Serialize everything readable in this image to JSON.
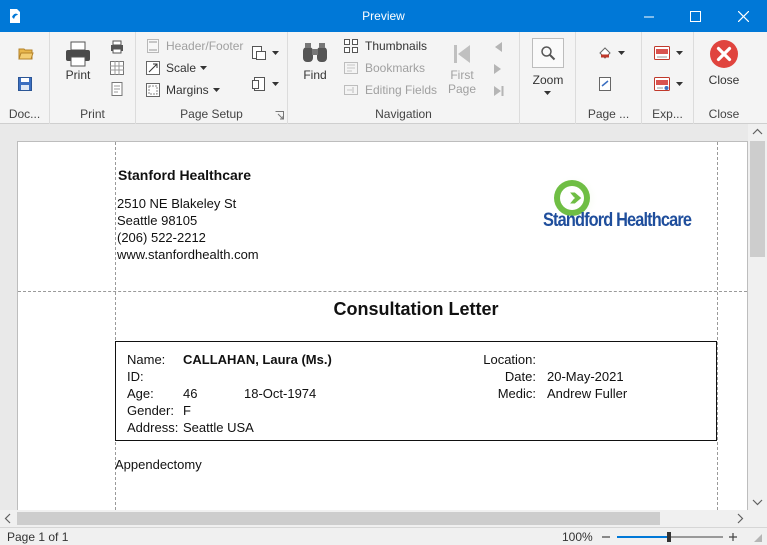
{
  "window": {
    "title": "Preview"
  },
  "ribbon": {
    "groups": {
      "document": "Doc...",
      "print": "Print",
      "page_setup": "Page Setup",
      "navigation": "Navigation",
      "zoom": "",
      "page_background": "Page ...",
      "export": "Exp...",
      "close": "Close"
    },
    "buttons": {
      "print": "Print",
      "header_footer": "Header/Footer",
      "scale": "Scale",
      "margins": "Margins",
      "find": "Find",
      "thumbnails": "Thumbnails",
      "bookmarks": "Bookmarks",
      "editing_fields": "Editing Fields",
      "first_page_line1": "First",
      "first_page_line2": "Page",
      "zoom": "Zoom",
      "close": "Close"
    }
  },
  "document": {
    "company": "Stanford Healthcare",
    "address_line": "2510 NE Blakeley St",
    "city_line": "Seattle 98105",
    "phone": "(206) 522-2212",
    "website": "www.stanfordhealth.com",
    "logo_text": "Standford Healthcare",
    "letter_title": "Consultation Letter",
    "labels": {
      "name": "Name:",
      "id": "ID:",
      "age": "Age:",
      "gender": "Gender:",
      "address": "Address:",
      "location": "Location:",
      "date": "Date:",
      "medic": "Medic:"
    },
    "values": {
      "name": "CALLAHAN, Laura (Ms.)",
      "id": "",
      "age": "46",
      "birth_date": "18-Oct-1974",
      "gender": "F",
      "address": "Seattle USA",
      "location": "",
      "date": "20-May-2021",
      "medic": "Andrew Fuller"
    },
    "body_text": "Appendectomy"
  },
  "status": {
    "page_info": "Page 1 of 1",
    "zoom_level": "100%"
  },
  "colors": {
    "titlebar": "#0078d7",
    "close_button": "#e0443e",
    "logo_green": "#6fbe44",
    "logo_blue": "#1f4e9c"
  }
}
